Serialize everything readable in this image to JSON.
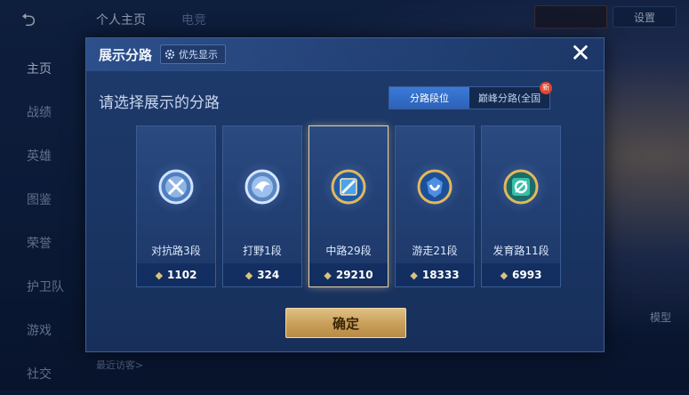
{
  "background": {
    "back_label": "⮌",
    "top_tabs": [
      "个人主页",
      "电竞"
    ],
    "settings_label": "设置",
    "sidebar": [
      "主页",
      "战绩",
      "英雄",
      "图鉴",
      "荣誉",
      "护卫队",
      "游戏",
      "社交"
    ],
    "recent_visitors": "最近访客>",
    "model_label": "模型"
  },
  "modal": {
    "title": "展示分路",
    "priority_label": "优先显示",
    "close_label": "✕",
    "subtitle": "请选择展示的分路",
    "tabs": [
      {
        "label": "分路段位",
        "active": true
      },
      {
        "label": "巅峰分路(全国",
        "active": false,
        "badge": "新"
      }
    ],
    "cards": [
      {
        "name": "对抗路3段",
        "score": "1102",
        "icon": "clash-lane-emblem",
        "selected": false
      },
      {
        "name": "打野1段",
        "score": "324",
        "icon": "jungle-emblem",
        "selected": false
      },
      {
        "name": "中路29段",
        "score": "29210",
        "icon": "mid-lane-emblem",
        "selected": true
      },
      {
        "name": "游走21段",
        "score": "18333",
        "icon": "roam-emblem",
        "selected": false
      },
      {
        "name": "发育路11段",
        "score": "6993",
        "icon": "farm-lane-emblem",
        "selected": false
      }
    ],
    "confirm_label": "确定"
  },
  "colors": {
    "accent_gold": "#c89e58",
    "tab_active": "#3a7ad8",
    "panel": "#1e3a6b"
  }
}
